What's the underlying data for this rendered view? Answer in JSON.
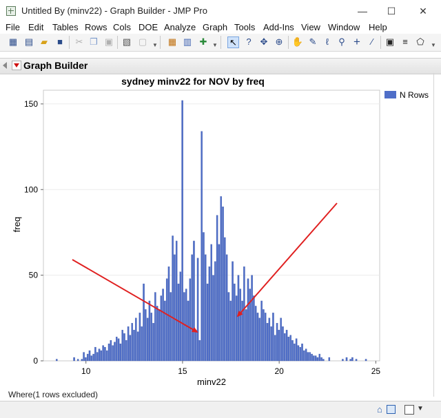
{
  "window": {
    "title": "Untitled By (minv22) - Graph Builder - JMP Pro",
    "minimize": "—",
    "maximize": "☐",
    "close": "✕"
  },
  "menu": [
    "File",
    "Edit",
    "Tables",
    "Rows",
    "Cols",
    "DOE",
    "Analyze",
    "Graph",
    "Tools",
    "Add-Ins",
    "View",
    "Window",
    "Help"
  ],
  "toolbar_icons": [
    "new-data-table-icon",
    "new-script-icon",
    "open-icon",
    "save-icon",
    "cut-icon",
    "copy-icon",
    "paste-icon",
    "journal-icon",
    "lock-icon",
    "data-grid-icon",
    "distribution-icon",
    "add-rows-icon",
    "arrow-tool-icon",
    "help-tool-icon",
    "selection-tool-icon",
    "scroller-tool-icon",
    "grabber-tool-icon",
    "brush-tool-icon",
    "lasso-tool-icon",
    "magnifier-tool-icon",
    "crosshair-tool-icon",
    "ruler-tool-icon",
    "annotate-tool-icon",
    "line-tool-icon",
    "polygon-tool-icon"
  ],
  "report": {
    "title": "Graph Builder"
  },
  "status": {
    "where": "Where(1 rows excluded)"
  },
  "chart_data": {
    "type": "bar",
    "title": "sydney minv22 for NOV by freq",
    "xlabel": "minv22",
    "ylabel": "freq",
    "xlim": [
      7.8,
      25.2
    ],
    "ylim": [
      0,
      158
    ],
    "xticks": [
      10,
      15,
      20,
      25
    ],
    "yticks": [
      0,
      50,
      100,
      150
    ],
    "bin_width": 0.1,
    "color": "#4f6ec8",
    "legend": {
      "entries": [
        "N Rows"
      ],
      "placement": "right"
    },
    "series": [
      {
        "name": "N Rows",
        "x": [
          8.5,
          9.4,
          9.6,
          9.8,
          9.9,
          10.0,
          10.1,
          10.2,
          10.3,
          10.4,
          10.5,
          10.6,
          10.7,
          10.8,
          10.9,
          11.0,
          11.1,
          11.2,
          11.3,
          11.4,
          11.5,
          11.6,
          11.7,
          11.8,
          11.9,
          12.0,
          12.1,
          12.2,
          12.3,
          12.4,
          12.5,
          12.6,
          12.7,
          12.8,
          12.9,
          13.0,
          13.1,
          13.2,
          13.3,
          13.4,
          13.5,
          13.6,
          13.7,
          13.8,
          13.9,
          14.0,
          14.1,
          14.2,
          14.3,
          14.4,
          14.5,
          14.6,
          14.7,
          14.8,
          14.9,
          15.0,
          15.1,
          15.2,
          15.3,
          15.4,
          15.5,
          15.6,
          15.7,
          15.8,
          15.9,
          16.0,
          16.1,
          16.2,
          16.3,
          16.4,
          16.5,
          16.6,
          16.7,
          16.8,
          16.9,
          17.0,
          17.1,
          17.2,
          17.3,
          17.4,
          17.5,
          17.6,
          17.7,
          17.8,
          17.9,
          18.0,
          18.1,
          18.2,
          18.3,
          18.4,
          18.5,
          18.6,
          18.7,
          18.8,
          18.9,
          19.0,
          19.1,
          19.2,
          19.3,
          19.4,
          19.5,
          19.6,
          19.7,
          19.8,
          19.9,
          20.0,
          20.1,
          20.2,
          20.3,
          20.4,
          20.5,
          20.6,
          20.7,
          20.8,
          20.9,
          21.0,
          21.1,
          21.2,
          21.3,
          21.4,
          21.5,
          21.6,
          21.7,
          21.8,
          21.9,
          22.0,
          22.1,
          22.2,
          22.3,
          22.6,
          23.3,
          23.5,
          23.7,
          23.8,
          24.0,
          24.5
        ],
        "values": [
          1,
          2,
          1,
          1,
          5,
          2,
          4,
          6,
          3,
          4,
          8,
          5,
          7,
          6,
          9,
          8,
          6,
          10,
          12,
          9,
          11,
          14,
          13,
          10,
          18,
          16,
          12,
          20,
          15,
          22,
          18,
          25,
          17,
          28,
          20,
          45,
          30,
          25,
          35,
          28,
          22,
          40,
          32,
          30,
          38,
          42,
          35,
          48,
          55,
          40,
          73,
          62,
          70,
          45,
          52,
          152,
          40,
          42,
          35,
          48,
          62,
          70,
          18,
          60,
          12,
          134,
          75,
          62,
          45,
          55,
          68,
          50,
          58,
          85,
          68,
          96,
          90,
          72,
          62,
          40,
          35,
          58,
          45,
          38,
          50,
          42,
          35,
          55,
          30,
          48,
          42,
          50,
          38,
          32,
          28,
          25,
          35,
          30,
          28,
          22,
          25,
          20,
          28,
          15,
          22,
          18,
          25,
          20,
          16,
          18,
          14,
          15,
          12,
          10,
          13,
          9,
          8,
          10,
          6,
          7,
          5,
          5,
          4,
          3,
          3,
          2,
          4,
          2,
          1,
          2,
          1,
          2,
          1,
          2,
          1,
          1
        ]
      }
    ]
  }
}
